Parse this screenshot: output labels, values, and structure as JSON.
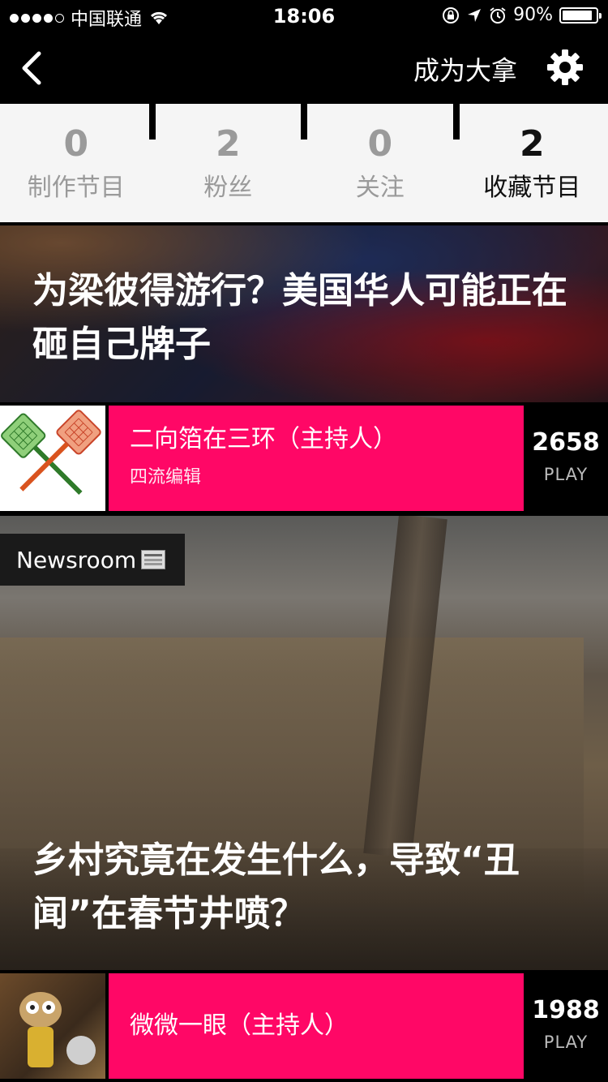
{
  "status_bar": {
    "carrier": "中国联通",
    "time": "18:06",
    "battery_percent": "90%",
    "battery_level": 0.9
  },
  "nav": {
    "back_icon": "chevron-left-icon",
    "action_label": "成为大拿",
    "settings_icon": "gear-icon"
  },
  "stats": [
    {
      "count": "0",
      "label": "制作节目"
    },
    {
      "count": "2",
      "label": "粉丝"
    },
    {
      "count": "0",
      "label": "关注"
    },
    {
      "count": "2",
      "label": "收藏节目"
    }
  ],
  "cards": [
    {
      "title": "为梁彼得游行？美国华人可能正在砸自己牌子",
      "host": "二向箔在三环（主持人）",
      "role": "四流编辑",
      "plays": "2658",
      "play_label": "PLAY"
    },
    {
      "tag": "Newsroom",
      "title": "乡村究竟在发生什么，导致“丑闻”在春节井喷？",
      "host": "微微一眼（主持人）",
      "plays": "1988",
      "play_label": "PLAY"
    }
  ],
  "colors": {
    "accent_pink": "#ff0766",
    "stats_bg": "#f5f5f5",
    "active_stat": "#111111",
    "inactive_stat": "#9a9a9a"
  }
}
